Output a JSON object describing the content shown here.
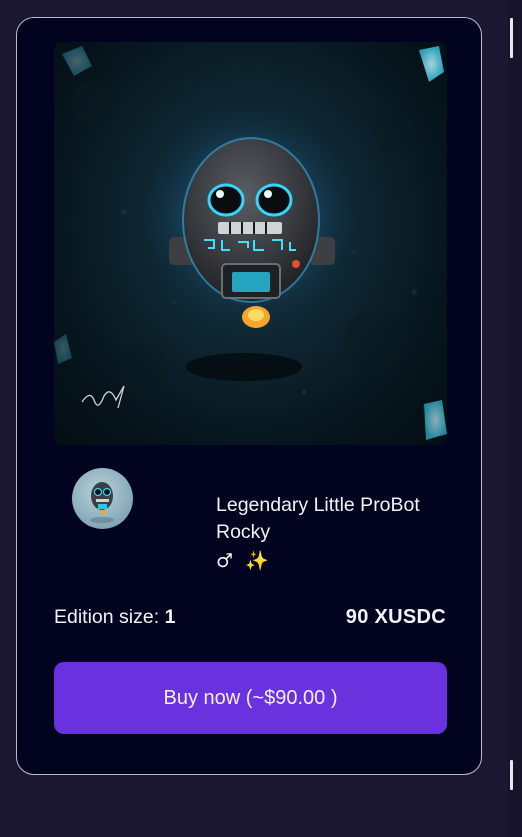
{
  "nft": {
    "title": "Legendary Little ProBot Rocky",
    "emoji_gender": "♂",
    "emoji_sparkle": "✨",
    "edition_label": "Edition size:",
    "edition_value": "1",
    "price": "90 XUSDC",
    "image_name": "probot-rocky-artwork",
    "avatar_name": "creator-avatar"
  },
  "actions": {
    "buy_label": "Buy now (~$90.00 )"
  },
  "colors": {
    "page_bg": "#1c1730",
    "card_bg": "#02031f",
    "card_border": "#bcbccd",
    "button_bg": "#6a32df",
    "text": "#f2f2f7"
  }
}
